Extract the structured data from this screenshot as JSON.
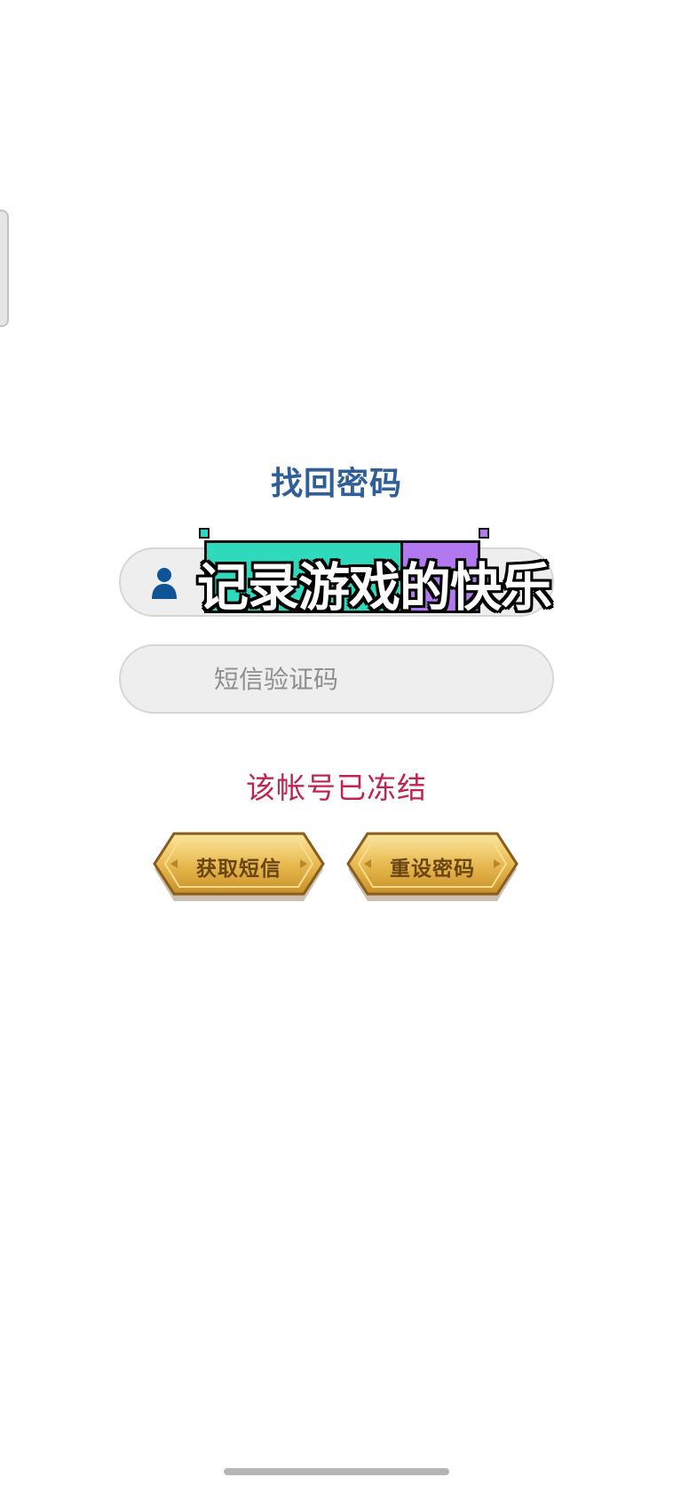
{
  "page": {
    "title": "找回密码"
  },
  "form": {
    "account_placeholder": "",
    "sms_code_placeholder": "短信验证码",
    "status_message": "该帐号已冻结"
  },
  "buttons": {
    "get_sms": "获取短信",
    "reset_password": "重设密码"
  },
  "overlay": {
    "caption": "记录游戏的快乐"
  },
  "icons": {
    "account_icon": "user-icon"
  },
  "colors": {
    "title": "#2f5f98",
    "status": "#c0234e",
    "button_gold": "#e7b64a",
    "overlay_teal": "#2fd9bc",
    "overlay_purple": "#b278f0"
  }
}
